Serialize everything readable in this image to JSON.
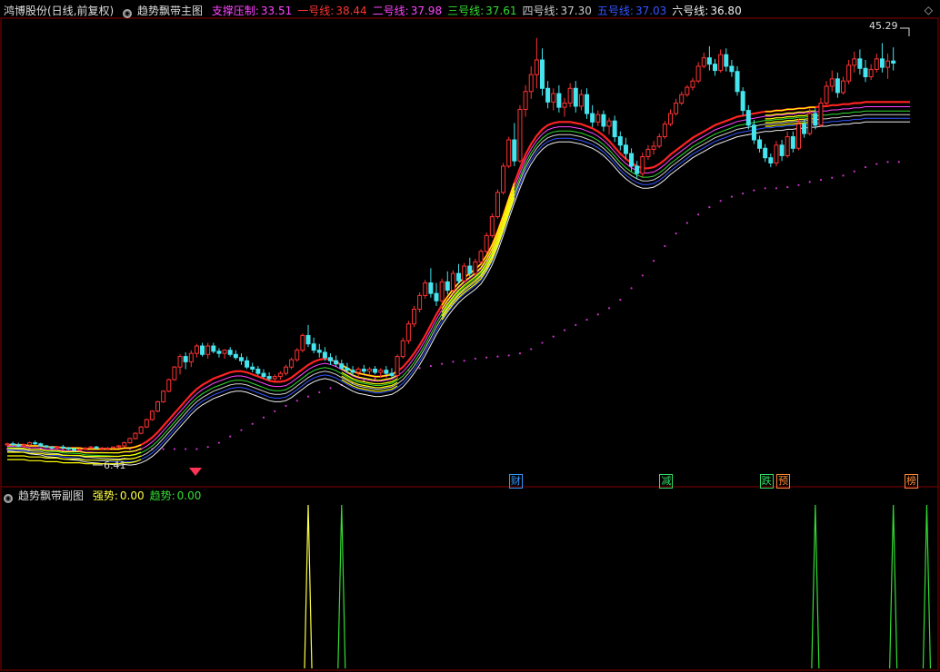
{
  "header": {
    "stock": "鸿博股份(日线,前复权)",
    "indicator": "趋势飘带主图",
    "lines": [
      {
        "label": "支撑压制:",
        "value": "33.51",
        "color": "#ff44ff"
      },
      {
        "label": "一号线:",
        "value": "38.44",
        "color": "#ff3333"
      },
      {
        "label": "二号线:",
        "value": "37.98",
        "color": "#ff44ff"
      },
      {
        "label": "三号线:",
        "value": "37.61",
        "color": "#33dd33"
      },
      {
        "label": "四号线:",
        "value": "37.30",
        "color": "#cccccc"
      },
      {
        "label": "五号线:",
        "value": "37.03",
        "color": "#3355ff"
      },
      {
        "label": "六号线:",
        "value": "36.80",
        "color": "#eeeeee"
      }
    ]
  },
  "sub_header": {
    "indicator": "趋势飘带副图",
    "items": [
      {
        "label": "强势:",
        "value": "0.00",
        "color": "#ffff44"
      },
      {
        "label": "趋势:",
        "value": "0.00",
        "color": "#33dd33"
      }
    ]
  },
  "annotations": {
    "high": "45.29",
    "low": "6.41",
    "diamond": "◇"
  },
  "badges": [
    {
      "text": "财",
      "color": "#3399ff",
      "index": 91
    },
    {
      "text": "减",
      "color": "#33dd66",
      "index": 118
    },
    {
      "text": "跌",
      "color": "#33dd66",
      "index": 136
    },
    {
      "text": "预",
      "color": "#ff8833",
      "index": 139
    },
    {
      "text": "榜",
      "color": "#ff8833",
      "index": 162
    }
  ],
  "colors": {
    "up": "#ff3333",
    "down": "#44e5ee",
    "support": "#cc33cc",
    "ribbon_up": "#ff2222",
    "ribbon_down": "#ffff00",
    "strong_spike": "#ffff44",
    "trend_spike": "#33dd33",
    "grid": "#880000"
  },
  "chart_data": {
    "type": "candlestick",
    "y_range": [
      4,
      47
    ],
    "support_line": [
      6.2,
      6.2,
      6.2,
      6.2,
      6.2,
      6.2,
      6.2,
      6.2,
      6.2,
      6.2,
      6.2,
      6.2,
      6.2,
      6.2,
      6.2,
      6.2,
      6.2,
      6.2,
      6.2,
      6.2,
      6.2,
      6.2,
      6.2,
      6.2,
      6.2,
      6.2,
      6.2,
      6.2,
      6.2,
      6.2,
      6.2,
      6.2,
      6.2,
      6.2,
      6.2,
      6.3,
      6.4,
      6.6,
      6.8,
      7.1,
      7.4,
      7.7,
      8.0,
      8.3,
      8.6,
      8.9,
      9.2,
      9.5,
      9.8,
      10.0,
      10.3,
      10.5,
      10.8,
      11.0,
      11.2,
      11.4,
      11.6,
      11.8,
      12.0,
      12.1,
      12.3,
      12.4,
      12.5,
      12.6,
      12.7,
      12.8,
      12.9,
      13.0,
      13.1,
      13.3,
      13.5,
      13.6,
      13.7,
      13.8,
      13.9,
      14.0,
      14.1,
      14.2,
      14.3,
      14.4,
      14.5,
      14.6,
      14.6,
      14.7,
      14.8,
      14.8,
      14.9,
      14.9,
      15.0,
      15.0,
      15.1,
      15.1,
      15.3,
      15.5,
      15.7,
      16.0,
      16.3,
      16.6,
      16.9,
      17.2,
      17.5,
      17.8,
      18.0,
      18.3,
      18.5,
      18.8,
      19.0,
      19.3,
      19.6,
      20.0,
      20.4,
      20.9,
      21.5,
      22.1,
      22.7,
      23.4,
      24.1,
      24.8,
      25.5,
      26.1,
      26.7,
      27.2,
      27.7,
      28.1,
      28.5,
      28.9,
      29.2,
      29.5,
      29.8,
      30.0,
      30.2,
      30.4,
      30.5,
      30.6,
      30.8,
      30.9,
      31.0,
      31.0,
      31.0,
      31.0,
      31.1,
      31.2,
      31.3,
      31.4,
      31.6,
      31.7,
      31.8,
      31.9,
      32.0,
      32.1,
      32.2,
      32.4,
      32.6,
      32.8,
      33.0,
      33.1,
      33.3,
      33.4,
      33.5,
      33.5,
      33.5
    ],
    "line1": [
      6.6,
      6.6,
      6.6,
      6.6,
      6.5,
      6.5,
      6.5,
      6.4,
      6.4,
      6.4,
      6.3,
      6.3,
      6.3,
      6.3,
      6.2,
      6.2,
      6.2,
      6.2,
      6.2,
      6.2,
      6.2,
      6.3,
      6.3,
      6.4,
      6.6,
      6.9,
      7.3,
      7.8,
      8.4,
      9.0,
      9.6,
      10.2,
      10.8,
      11.4,
      11.9,
      12.3,
      12.6,
      12.9,
      13.1,
      13.3,
      13.5,
      13.6,
      13.6,
      13.5,
      13.3,
      13.1,
      12.9,
      12.7,
      12.6,
      12.6,
      12.7,
      13.0,
      13.4,
      13.8,
      14.2,
      14.5,
      14.7,
      14.8,
      14.7,
      14.5,
      14.2,
      13.9,
      13.6,
      13.4,
      13.3,
      13.2,
      13.1,
      13.1,
      13.2,
      13.3,
      13.6,
      14.0,
      14.6,
      15.3,
      16.1,
      17.0,
      18.0,
      19.0,
      19.9,
      20.7,
      21.4,
      22.0,
      22.5,
      22.9,
      23.3,
      23.8,
      24.6,
      25.6,
      26.9,
      28.4,
      30.0,
      31.5,
      32.9,
      34.2,
      35.2,
      36.0,
      36.6,
      37.0,
      37.2,
      37.3,
      37.3,
      37.3,
      37.2,
      37.1,
      36.9,
      36.7,
      36.4,
      36.0,
      35.5,
      34.9,
      34.3,
      33.8,
      33.4,
      33.1,
      32.9,
      32.9,
      33.0,
      33.3,
      33.7,
      34.2,
      34.6,
      35.0,
      35.4,
      35.8,
      36.1,
      36.4,
      36.7,
      37.0,
      37.2,
      37.4,
      37.6,
      37.8,
      37.9,
      38.0,
      38.1,
      38.2,
      38.3,
      38.3,
      38.4,
      38.4,
      38.5,
      38.5,
      38.6,
      38.6,
      38.7,
      38.7,
      38.8,
      38.8,
      38.9,
      38.9,
      39.0,
      39.0,
      39.1,
      39.1,
      39.2,
      39.2,
      39.2,
      39.2,
      39.2,
      39.2,
      39.2,
      39.2,
      39.2
    ],
    "trend_segments": [
      [
        0,
        1,
        0
      ],
      [
        20,
        2,
        1
      ],
      [
        60,
        1,
        1
      ],
      [
        91,
        2,
        1
      ],
      [
        136,
        1,
        0
      ],
      [
        145,
        2,
        1
      ]
    ],
    "candles": [
      [
        6.6,
        6.8,
        6.4,
        6.7
      ],
      [
        6.7,
        6.9,
        6.5,
        6.6
      ],
      [
        6.6,
        6.8,
        6.4,
        6.5
      ],
      [
        6.5,
        6.7,
        6.3,
        6.6
      ],
      [
        6.6,
        6.9,
        6.5,
        6.8
      ],
      [
        6.8,
        7.0,
        6.6,
        6.7
      ],
      [
        6.7,
        6.8,
        6.4,
        6.5
      ],
      [
        6.5,
        6.6,
        6.3,
        6.4
      ],
      [
        6.4,
        6.5,
        6.2,
        6.3
      ],
      [
        6.3,
        6.5,
        6.1,
        6.4
      ],
      [
        6.4,
        6.6,
        6.2,
        6.3
      ],
      [
        6.3,
        6.4,
        6.1,
        6.2
      ],
      [
        6.2,
        6.3,
        6.0,
        6.1
      ],
      [
        6.1,
        6.3,
        6.0,
        6.2
      ],
      [
        6.2,
        6.4,
        6.1,
        6.3
      ],
      [
        6.3,
        6.5,
        6.2,
        6.4
      ],
      [
        6.4,
        6.5,
        6.2,
        6.3
      ],
      [
        6.3,
        6.4,
        6.2,
        6.3
      ],
      [
        6.3,
        6.4,
        6.2,
        6.3
      ],
      [
        6.3,
        6.4,
        6.2,
        6.4
      ],
      [
        6.4,
        6.6,
        6.3,
        6.5
      ],
      [
        6.5,
        6.9,
        6.4,
        6.8
      ],
      [
        6.8,
        7.3,
        6.7,
        7.2
      ],
      [
        7.2,
        7.8,
        7.1,
        7.7
      ],
      [
        7.7,
        8.4,
        7.6,
        8.3
      ],
      [
        8.3,
        9.1,
        8.2,
        9.0
      ],
      [
        9.0,
        9.9,
        8.9,
        9.8
      ],
      [
        9.8,
        10.8,
        9.7,
        10.7
      ],
      [
        10.7,
        11.8,
        10.6,
        11.7
      ],
      [
        11.7,
        12.9,
        11.6,
        12.8
      ],
      [
        12.8,
        14.1,
        12.7,
        14.0
      ],
      [
        14.0,
        15.2,
        13.3,
        15.0
      ],
      [
        15.0,
        15.4,
        13.8,
        14.5
      ],
      [
        14.5,
        15.6,
        14.0,
        15.3
      ],
      [
        15.3,
        16.2,
        14.9,
        16.0
      ],
      [
        16.0,
        16.3,
        15.0,
        15.2
      ],
      [
        15.2,
        16.3,
        14.8,
        16.0
      ],
      [
        16.0,
        16.3,
        15.3,
        15.5
      ],
      [
        15.5,
        15.8,
        14.9,
        15.3
      ],
      [
        15.3,
        15.7,
        14.8,
        15.6
      ],
      [
        15.6,
        15.9,
        15.0,
        15.2
      ],
      [
        15.2,
        15.6,
        14.7,
        14.9
      ],
      [
        14.9,
        15.3,
        14.2,
        14.6
      ],
      [
        14.6,
        15.0,
        13.8,
        14.0
      ],
      [
        14.0,
        14.4,
        13.5,
        13.8
      ],
      [
        13.8,
        14.1,
        13.2,
        13.4
      ],
      [
        13.4,
        13.8,
        12.9,
        13.1
      ],
      [
        13.1,
        13.5,
        12.7,
        12.9
      ],
      [
        12.9,
        13.3,
        12.6,
        13.1
      ],
      [
        13.1,
        13.6,
        12.8,
        13.4
      ],
      [
        13.4,
        14.2,
        13.2,
        14.0
      ],
      [
        14.0,
        14.9,
        13.8,
        14.7
      ],
      [
        14.7,
        15.8,
        14.5,
        15.6
      ],
      [
        15.6,
        17.2,
        15.4,
        17.0
      ],
      [
        17.0,
        18.0,
        15.9,
        16.2
      ],
      [
        16.2,
        16.8,
        15.3,
        15.6
      ],
      [
        15.6,
        16.2,
        14.9,
        15.4
      ],
      [
        15.4,
        15.9,
        14.6,
        14.9
      ],
      [
        14.9,
        15.3,
        14.2,
        14.6
      ],
      [
        14.6,
        15.1,
        14.0,
        14.3
      ],
      [
        14.3,
        14.7,
        13.7,
        13.9
      ],
      [
        13.9,
        14.4,
        13.4,
        13.7
      ],
      [
        13.7,
        14.1,
        13.2,
        13.5
      ],
      [
        13.5,
        14.0,
        13.1,
        13.8
      ],
      [
        13.8,
        14.2,
        13.3,
        13.6
      ],
      [
        13.6,
        14.0,
        13.2,
        13.8
      ],
      [
        13.8,
        14.1,
        13.3,
        13.5
      ],
      [
        13.5,
        13.9,
        13.0,
        13.7
      ],
      [
        13.7,
        14.1,
        13.2,
        13.4
      ],
      [
        13.4,
        13.9,
        12.9,
        13.2
      ],
      [
        13.2,
        15.2,
        12.8,
        15.0
      ],
      [
        15.0,
        16.8,
        14.8,
        16.5
      ],
      [
        16.5,
        18.4,
        16.2,
        18.1
      ],
      [
        18.1,
        19.8,
        17.8,
        19.5
      ],
      [
        19.5,
        21.1,
        19.2,
        20.8
      ],
      [
        20.8,
        22.3,
        20.5,
        22.0
      ],
      [
        22.0,
        23.4,
        20.6,
        21.0
      ],
      [
        21.0,
        22.0,
        19.8,
        20.3
      ],
      [
        20.3,
        22.4,
        20.1,
        22.1
      ],
      [
        22.1,
        23.1,
        20.9,
        21.3
      ],
      [
        21.3,
        23.2,
        21.1,
        22.9
      ],
      [
        22.9,
        23.8,
        21.9,
        22.2
      ],
      [
        22.2,
        23.9,
        22.0,
        23.6
      ],
      [
        23.6,
        24.4,
        22.5,
        22.9
      ],
      [
        22.9,
        24.3,
        22.7,
        24.0
      ],
      [
        24.0,
        25.2,
        23.8,
        25.0
      ],
      [
        25.0,
        26.8,
        24.8,
        26.5
      ],
      [
        26.5,
        28.6,
        26.3,
        28.3
      ],
      [
        28.3,
        30.9,
        28.1,
        30.6
      ],
      [
        30.6,
        33.4,
        30.4,
        33.1
      ],
      [
        33.1,
        35.9,
        32.9,
        35.6
      ],
      [
        35.6,
        37.2,
        33.1,
        33.6
      ],
      [
        33.6,
        38.9,
        33.4,
        38.5
      ],
      [
        38.5,
        40.8,
        37.8,
        40.2
      ],
      [
        40.2,
        42.6,
        39.5,
        41.8
      ],
      [
        41.8,
        45.29,
        40.5,
        43.2
      ],
      [
        43.2,
        44.3,
        39.8,
        40.5
      ],
      [
        40.5,
        41.2,
        38.6,
        39.2
      ],
      [
        39.2,
        40.5,
        38.4,
        40.0
      ],
      [
        40.0,
        40.8,
        38.2,
        38.7
      ],
      [
        38.7,
        39.6,
        37.8,
        39.1
      ],
      [
        39.1,
        41.0,
        38.7,
        40.5
      ],
      [
        40.5,
        41.2,
        38.2,
        38.8
      ],
      [
        38.8,
        40.4,
        38.4,
        39.9
      ],
      [
        39.9,
        40.5,
        37.6,
        38.1
      ],
      [
        38.1,
        38.9,
        36.8,
        37.3
      ],
      [
        37.3,
        38.4,
        36.9,
        38.0
      ],
      [
        38.0,
        38.4,
        36.4,
        36.9
      ],
      [
        36.9,
        37.7,
        36.1,
        37.4
      ],
      [
        37.4,
        37.9,
        35.4,
        35.9
      ],
      [
        35.9,
        36.4,
        34.6,
        35.1
      ],
      [
        35.1,
        35.8,
        33.8,
        34.3
      ],
      [
        34.3,
        34.8,
        32.6,
        33.1
      ],
      [
        33.1,
        33.6,
        31.9,
        32.4
      ],
      [
        32.4,
        34.4,
        32.1,
        34.0
      ],
      [
        34.0,
        35.1,
        33.7,
        34.7
      ],
      [
        34.7,
        35.5,
        34.2,
        35.0
      ],
      [
        35.0,
        36.2,
        34.8,
        35.9
      ],
      [
        35.9,
        37.4,
        35.7,
        37.1
      ],
      [
        37.1,
        38.5,
        36.9,
        38.1
      ],
      [
        38.1,
        39.5,
        37.9,
        39.1
      ],
      [
        39.1,
        40.2,
        38.9,
        39.9
      ],
      [
        39.9,
        40.8,
        39.7,
        40.6
      ],
      [
        40.6,
        41.5,
        40.3,
        41.2
      ],
      [
        41.2,
        43.0,
        41.0,
        42.6
      ],
      [
        42.6,
        43.9,
        42.4,
        43.4
      ],
      [
        43.4,
        44.5,
        42.2,
        42.8
      ],
      [
        42.8,
        43.3,
        41.7,
        42.2
      ],
      [
        42.2,
        44.2,
        42.0,
        43.7
      ],
      [
        43.7,
        44.3,
        42.1,
        42.6
      ],
      [
        42.6,
        43.2,
        41.6,
        42.1
      ],
      [
        42.1,
        42.6,
        39.8,
        40.2
      ],
      [
        40.2,
        40.6,
        37.9,
        38.4
      ],
      [
        38.4,
        38.9,
        36.6,
        37.0
      ],
      [
        37.0,
        37.5,
        35.2,
        35.6
      ],
      [
        35.6,
        36.0,
        34.4,
        34.8
      ],
      [
        34.8,
        35.2,
        33.5,
        33.9
      ],
      [
        33.9,
        34.3,
        33.0,
        33.4
      ],
      [
        33.4,
        35.5,
        33.1,
        35.1
      ],
      [
        35.1,
        35.6,
        33.6,
        34.1
      ],
      [
        34.1,
        36.4,
        33.9,
        35.9
      ],
      [
        35.9,
        36.4,
        34.4,
        34.8
      ],
      [
        34.8,
        37.6,
        34.6,
        37.1
      ],
      [
        37.1,
        37.6,
        35.8,
        36.2
      ],
      [
        36.2,
        38.6,
        36.0,
        38.1
      ],
      [
        38.1,
        38.6,
        36.6,
        37.0
      ],
      [
        37.0,
        39.6,
        36.8,
        39.1
      ],
      [
        39.1,
        41.2,
        38.9,
        40.7
      ],
      [
        40.7,
        42.2,
        40.2,
        41.4
      ],
      [
        41.4,
        42.0,
        39.6,
        40.1
      ],
      [
        40.1,
        41.6,
        39.9,
        41.2
      ],
      [
        41.2,
        43.2,
        40.9,
        42.7
      ],
      [
        42.7,
        44.0,
        42.0,
        43.3
      ],
      [
        43.3,
        44.2,
        41.8,
        42.4
      ],
      [
        42.4,
        43.2,
        41.1,
        41.6
      ],
      [
        41.6,
        42.8,
        41.3,
        42.3
      ],
      [
        42.3,
        43.8,
        42.0,
        43.3
      ],
      [
        43.3,
        44.8,
        42.0,
        42.5
      ],
      [
        42.5,
        43.8,
        41.4,
        43.1
      ],
      [
        43.1,
        44.4,
        42.2,
        42.9
      ]
    ],
    "strong_spikes": [
      54
    ],
    "trend_spikes": [
      60,
      145,
      159,
      165
    ]
  }
}
